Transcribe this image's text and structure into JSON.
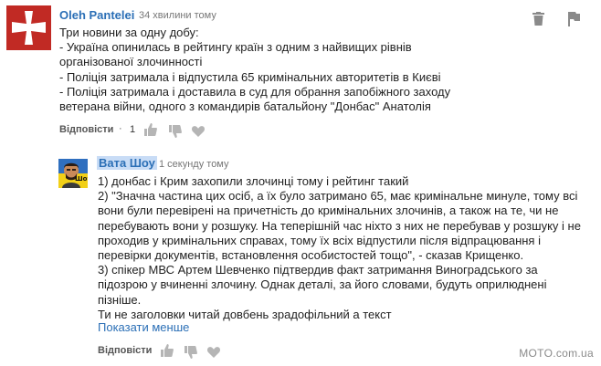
{
  "comment": {
    "author": "Oleh Pantelei",
    "time": "34 хвилини тому",
    "text": "Три новини за одну добу:\n- Україна опинилась в рейтингу країн з одним з найвищих рівнів\nорганізованої злочинності\n- Поліція затримала і відпустила 65 кримінальних авторитетів в Києві\n- Поліція затримала і доставила в суд для обрання запобіжного заходу\nветерана війни, одного з командирів батальйону \"Донбас\" Анатолія",
    "reply_label": "Відповісти",
    "like_count": "1",
    "icons": {
      "delete": "trash-icon",
      "flag": "flag-icon",
      "like": "thumbs-up-icon",
      "dislike": "thumbs-down-icon",
      "heart": "heart-icon"
    }
  },
  "reply": {
    "author": "Вата Шоу",
    "time": "1 секунду тому",
    "text": "1) донбас і Крим захопили злочинці тому і рейтинг такий\n2) \"Значна частина цих осіб, а їх було затримано 65, має кримінальне минуле, тому всі\nвони були перевірені на причетність до кримінальних злочинів, а також на те, чи не\nперебувають вони у розшуку. На теперішній час ніхто з них не перебував у розшуку і не\nпроходив у кримінальних справах, тому їх всіх відпустили після відпрацювання і\nперевірки документів, встановлення особистостей тощо\", - сказав Крищенко.\n3) спікер МВС Артем Шевченко підтвердив факт затримання Виноградського за\nпідозрою у вчиненні злочину. Однак деталі, за його словами, будуть оприлюднені\nпізніше.\nТи не заголовки читай довбень зрадофільний а текст",
    "show_less": "Показати менше",
    "reply_label": "Відповісти",
    "avatar_text": "Шоу",
    "icons": {
      "like": "thumbs-up-icon",
      "dislike": "thumbs-down-icon",
      "heart": "heart-icon"
    }
  },
  "watermark": "MOTO.com.ua",
  "colors": {
    "author": "#2b6fb6",
    "avatar_red": "#c12a24",
    "flag_blue": "#2f6fbf",
    "flag_yellow": "#f2d017"
  }
}
